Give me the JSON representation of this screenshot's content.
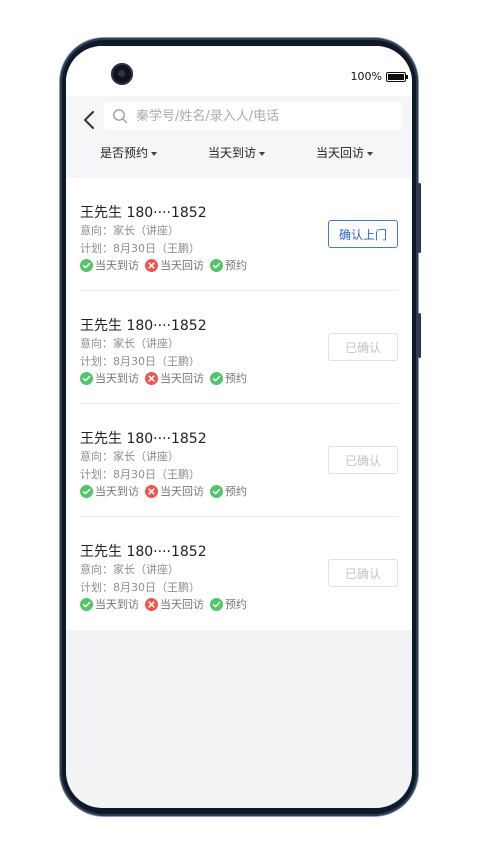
{
  "status": {
    "battery": "100%"
  },
  "search": {
    "placeholder": "秦学号/姓名/录入人/电话"
  },
  "filters": [
    {
      "label": "是否预约"
    },
    {
      "label": "当天到访"
    },
    {
      "label": "当天回访"
    }
  ],
  "records": [
    {
      "name": "王先生",
      "phone": "180····1852",
      "intent": "意向：家长（讲座）",
      "plan": "计划：8月30日（王鹏）",
      "tags": [
        {
          "label": "当天到访",
          "state": "ok"
        },
        {
          "label": "当天回访",
          "state": "no"
        },
        {
          "label": "预约",
          "state": "ok"
        }
      ],
      "action": {
        "label": "确认上门",
        "state": "primary"
      }
    },
    {
      "name": "王先生",
      "phone": "180····1852",
      "intent": "意向：家长（讲座）",
      "plan": "计划：8月30日（王鹏）",
      "tags": [
        {
          "label": "当天到访",
          "state": "ok"
        },
        {
          "label": "当天回访",
          "state": "no"
        },
        {
          "label": "预约",
          "state": "ok"
        }
      ],
      "action": {
        "label": "已确认",
        "state": "disabled"
      }
    },
    {
      "name": "王先生",
      "phone": "180····1852",
      "intent": "意向：家长（讲座）",
      "plan": "计划：8月30日（王鹏）",
      "tags": [
        {
          "label": "当天到访",
          "state": "ok"
        },
        {
          "label": "当天回访",
          "state": "no"
        },
        {
          "label": "预约",
          "state": "ok"
        }
      ],
      "action": {
        "label": "已确认",
        "state": "disabled"
      }
    },
    {
      "name": "王先生",
      "phone": "180····1852",
      "intent": "意向：家长（讲座）",
      "plan": "计划：8月30日（王鹏）",
      "tags": [
        {
          "label": "当天到访",
          "state": "ok"
        },
        {
          "label": "当天回访",
          "state": "no"
        },
        {
          "label": "预约",
          "state": "ok"
        }
      ],
      "action": {
        "label": "已确认",
        "state": "disabled"
      }
    }
  ],
  "colors": {
    "accent": "#2f63c4",
    "ok": "#52c46a",
    "no": "#e8584f"
  },
  "icons": {
    "back": "chevron-left-icon",
    "search": "search-icon",
    "ok": "check-circle-icon",
    "no": "x-circle-icon"
  }
}
